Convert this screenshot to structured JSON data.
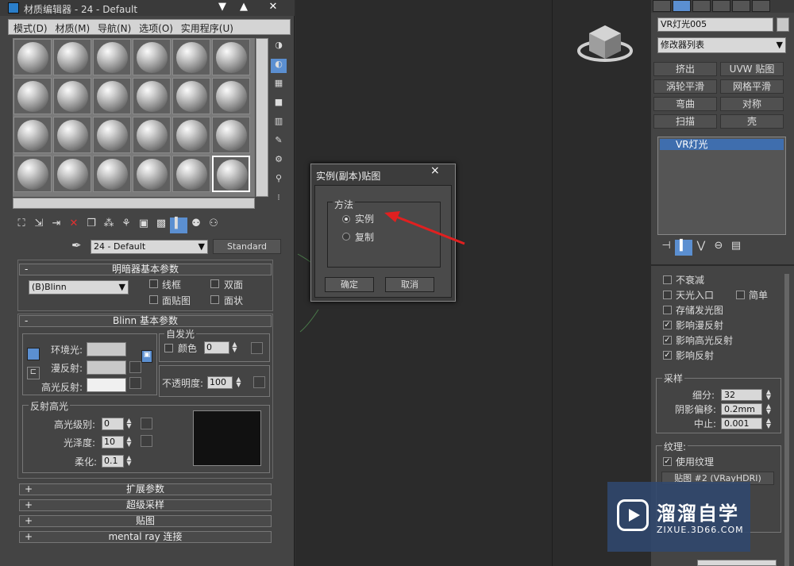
{
  "material_editor": {
    "title": "材质编辑器 - 24 - Default",
    "menu": [
      "模式(D)",
      "材质(M)",
      "导航(N)",
      "选项(O)",
      "实用程序(U)"
    ],
    "material_name": "24 - Default",
    "material_type": "Standard",
    "shader_rollout": {
      "title": "明暗器基本参数",
      "shader": "(B)Blinn",
      "options": [
        "线框",
        "双面",
        "面贴图",
        "面状"
      ]
    },
    "blinn_rollout": {
      "title": "Blinn 基本参数",
      "ambient_label": "环境光:",
      "diffuse_label": "漫反射:",
      "specular_label": "高光反射:",
      "self_illum_group": "自发光",
      "color_label": "颜色",
      "self_illum_value": "0",
      "opacity_label": "不透明度:",
      "opacity_value": "100",
      "spec_group": "反射高光",
      "spec_level_label": "高光级别:",
      "spec_level_value": "0",
      "gloss_label": "光泽度:",
      "gloss_value": "10",
      "soften_label": "柔化:",
      "soften_value": "0.1"
    },
    "collapsed_rollouts": [
      "扩展参数",
      "超级采样",
      "贴图",
      "mental ray 连接"
    ]
  },
  "dialog": {
    "title": "实例(副本)贴图",
    "close": "×",
    "group": "方法",
    "options": [
      "实例",
      "复制"
    ],
    "selected": "实例",
    "ok": "确定",
    "cancel": "取消"
  },
  "command_panel": {
    "object_name": "VR灯光005",
    "modifier_list": "修改器列表",
    "modifier_buttons": [
      "挤出",
      "UVW 贴图",
      "涡轮平滑",
      "网格平滑",
      "弯曲",
      "对称",
      "扫描",
      "壳"
    ],
    "stack_item": "VR灯光",
    "options": {
      "no_decay": "不衰减",
      "skylight_portal": "天光入口",
      "simple": "简单",
      "store_irradiance": "存储发光图",
      "affect_diffuse": "影响漫反射",
      "affect_specular": "影响高光反射",
      "affect_reflections": "影响反射"
    },
    "checked": {
      "affect_diffuse": true,
      "affect_specular": true,
      "affect_reflections": true,
      "use_texture": true
    },
    "sampling": {
      "title": "采样",
      "subdivs_label": "细分:",
      "subdivs_value": "32",
      "shadow_bias_label": "阴影偏移:",
      "shadow_bias_value": "0.2mm",
      "cutoff_label": "中止:",
      "cutoff_value": "0.001"
    },
    "texture": {
      "title": "纹理:",
      "use_texture": "使用纹理",
      "map_button": "贴图 #2 (VRayHDRI)"
    }
  },
  "watermark": {
    "title": "溜溜自学",
    "url": "ZIXUE.3D66.COM"
  },
  "colors": {
    "selection_blue": "#5b8fd1",
    "arrow_red": "#e02020",
    "watermark_bg": "#30486e"
  }
}
